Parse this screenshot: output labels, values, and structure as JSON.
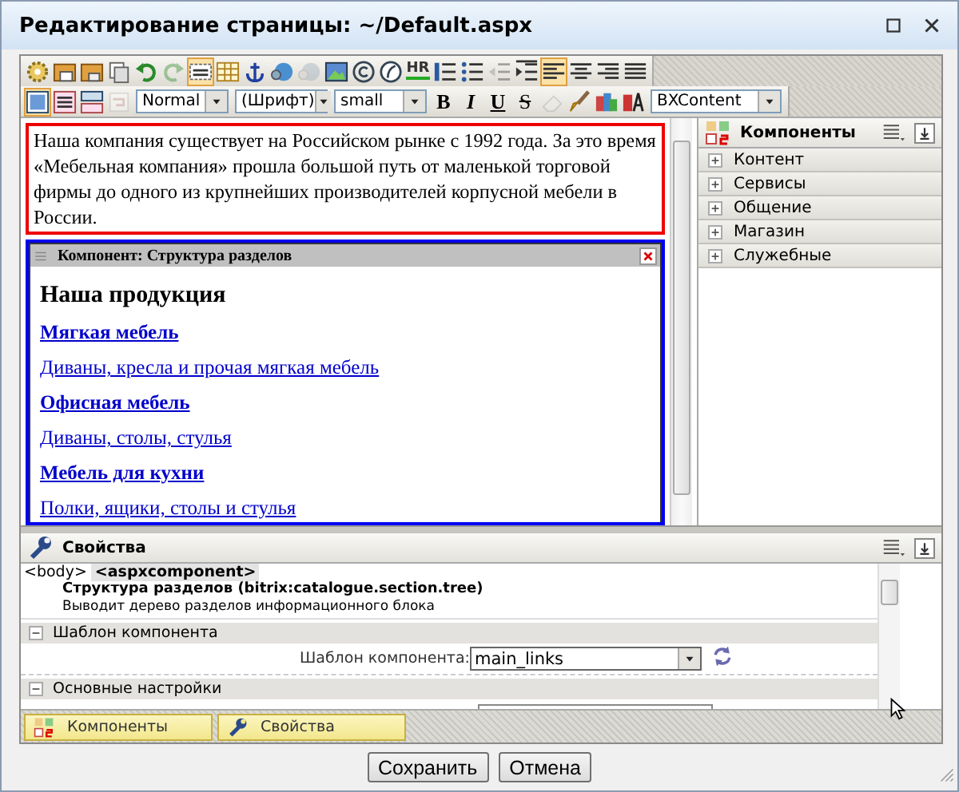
{
  "window": {
    "title": "Редактирование страницы: ~/Default.aspx"
  },
  "toolbar_1": [
    {
      "selected": false,
      "disabled": false
    },
    {
      "selected": false,
      "disabled": false
    },
    {
      "selected": false,
      "disabled": false
    },
    {
      "selected": false,
      "disabled": false
    },
    {
      "selected": false,
      "disabled": false
    },
    {
      "selected": false,
      "disabled": true
    },
    {
      "selected": true,
      "disabled": false
    },
    {
      "selected": false,
      "disabled": false
    },
    {
      "selected": false,
      "disabled": false
    },
    {
      "selected": false,
      "disabled": false
    },
    {
      "selected": false,
      "disabled": true
    },
    {
      "selected": false,
      "disabled": false
    },
    {
      "selected": false,
      "disabled": false
    },
    {
      "selected": false,
      "disabled": false
    },
    {
      "selected": false,
      "disabled": false,
      "label": "HR"
    },
    {
      "selected": false,
      "disabled": false
    },
    {
      "selected": false,
      "disabled": false
    },
    {
      "selected": false,
      "disabled": true
    },
    {
      "selected": false,
      "disabled": false
    },
    {
      "selected": true,
      "disabled": false
    },
    {
      "selected": false,
      "disabled": false
    },
    {
      "selected": false,
      "disabled": false
    },
    {
      "selected": false,
      "disabled": false
    }
  ],
  "toolbar_2": {
    "view_buttons": [
      {
        "selected": true,
        "disabled": false
      },
      {
        "selected": false,
        "disabled": false
      },
      {
        "selected": false,
        "disabled": false
      },
      {
        "selected": false,
        "disabled": true
      }
    ],
    "style_select": "Normal",
    "font_select": "(Шрифт)",
    "size_select": "small",
    "format_buttons": [
      {
        "label": "B",
        "kind": "bold"
      },
      {
        "label": "I",
        "kind": "italic"
      },
      {
        "label": "U",
        "kind": "underline"
      },
      {
        "label": "S",
        "kind": "strike"
      }
    ],
    "tools": [
      {
        "disabled": true
      },
      {
        "disabled": false
      },
      {
        "disabled": false
      },
      {
        "disabled": false
      }
    ],
    "template_select": "BXContent"
  },
  "editor": {
    "paragraph": "Наша компания существует на Российском рынке с 1992 года. За это время «Мебельная компания» прошла большой путь от маленькой торговой фирмы до одного из крупнейших производителей корпусной мебели в России.",
    "component": {
      "title": "Компонент: Структура разделов",
      "heading": "Наша продукция",
      "links": [
        {
          "text": "Мягкая мебель",
          "kind": "section"
        },
        {
          "text": "Диваны, кресла и прочая мягкая мебель",
          "kind": "description"
        },
        {
          "text": "Офисная мебель",
          "kind": "section"
        },
        {
          "text": "Диваны, столы, стулья",
          "kind": "description"
        },
        {
          "text": "Мебель для кухни",
          "kind": "section"
        },
        {
          "text": "Полки, ящики, столы и стулья",
          "kind": "description"
        }
      ]
    }
  },
  "components_panel": {
    "title": "Компоненты",
    "groups": [
      {
        "label": "Контент",
        "expanded": false
      },
      {
        "label": "Сервисы",
        "expanded": false
      },
      {
        "label": "Общение",
        "expanded": false
      },
      {
        "label": "Магазин",
        "expanded": false
      },
      {
        "label": "Служебные",
        "expanded": false
      }
    ]
  },
  "properties_panel": {
    "title": "Свойства",
    "breadcrumb": [
      {
        "text": "<body>",
        "selected": false
      },
      {
        "text": "<aspxcomponent>",
        "selected": true
      }
    ],
    "component_name": "Структура разделов (bitrix:catalogue.section.tree)",
    "component_description": "Выводит дерево разделов информационного блока",
    "groups": [
      {
        "title": "Шаблон компонента",
        "expanded": true,
        "fields": [
          {
            "label": "Шаблон компонента:",
            "value": "main_links"
          }
        ]
      },
      {
        "title": "Основные настройки",
        "expanded": true
      }
    ]
  },
  "bottom_tabs": [
    {
      "label": "Компоненты"
    },
    {
      "label": "Свойства"
    }
  ],
  "buttons": [
    {
      "label": "Сохранить"
    },
    {
      "label": "Отмена"
    }
  ]
}
